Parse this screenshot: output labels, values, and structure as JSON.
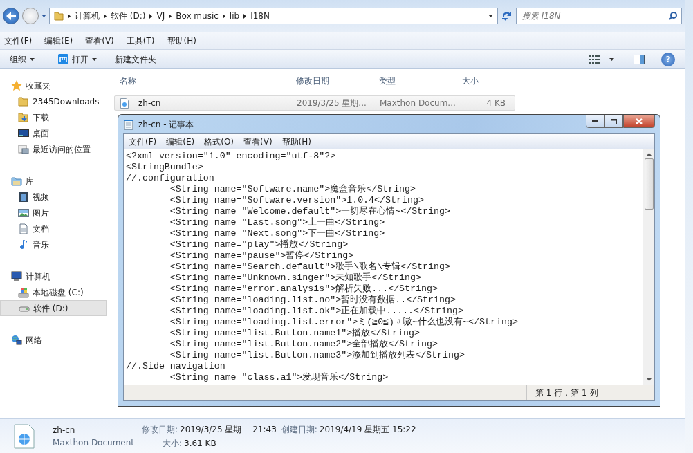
{
  "address_bar": {
    "crumbs": [
      "计算机",
      "软件 (D:)",
      "VJ",
      "Box music",
      "lib",
      "I18N"
    ]
  },
  "search": {
    "placeholder": "搜索 I18N"
  },
  "menu": [
    "文件(F)",
    "编辑(E)",
    "查看(V)",
    "工具(T)",
    "帮助(H)"
  ],
  "toolbar": {
    "organize": "组织",
    "open": "打开",
    "new_folder": "新建文件夹",
    "help": "?"
  },
  "sidebar": {
    "groups": [
      {
        "label": "收藏夹",
        "kind": "favorites",
        "children": [
          {
            "label": "2345Downloads",
            "kind": "folder",
            "selected": false
          },
          {
            "label": "下载",
            "kind": "download",
            "selected": false
          },
          {
            "label": "桌面",
            "kind": "desktop",
            "selected": false
          },
          {
            "label": "最近访问的位置",
            "kind": "recent",
            "selected": false
          }
        ]
      },
      {
        "label": "库",
        "kind": "library",
        "children": [
          {
            "label": "视频",
            "kind": "video",
            "selected": false
          },
          {
            "label": "图片",
            "kind": "image",
            "selected": false
          },
          {
            "label": "文档",
            "kind": "document",
            "selected": false
          },
          {
            "label": "音乐",
            "kind": "music",
            "selected": false
          }
        ]
      },
      {
        "label": "计算机",
        "kind": "computer",
        "children": [
          {
            "label": "本地磁盘 (C:)",
            "kind": "system-drive",
            "selected": false
          },
          {
            "label": "软件 (D:)",
            "kind": "drive",
            "selected": true
          }
        ]
      },
      {
        "label": "网络",
        "kind": "network"
      }
    ]
  },
  "file_list": {
    "columns": [
      "名称",
      "修改日期",
      "类型",
      "大小"
    ],
    "rows": [
      {
        "name": "zh-cn",
        "modified": "2019/3/25 星期...",
        "type": "Maxthon Docum...",
        "size": "4 KB",
        "selected": true
      }
    ]
  },
  "notepad": {
    "title": "zh-cn - 记事本",
    "menu": [
      "文件(F)",
      "编辑(E)",
      "格式(O)",
      "查看(V)",
      "帮助(H)"
    ],
    "lines": [
      "<?xml version=\"1.0\" encoding=\"utf-8\"?>",
      "<StringBundle>",
      "//.configuration",
      "\t<String name=\"Software.name\">魔盒音乐</String>",
      "\t<String name=\"Software.version\">1.0.4</String>",
      "\t<String name=\"Welcome.default\">一切尽在心情~</String>",
      "\t<String name=\"Last.song\">上一曲</String>",
      "\t<String name=\"Next.song\">下一曲</String>",
      "\t<String name=\"play\">播放</String>",
      "\t<String name=\"pause\">暂停</String>",
      "\t<String name=\"Search.default\">歌手\\歌名\\专辑</String>",
      "\t<String name=\"Unknown.singer\">未知歌手</String>",
      "\t<String name=\"error.analysis\">解析失败...</String>",
      "\t<String name=\"loading.list.no\">暂时没有数据..</String>",
      "\t<String name=\"loading.list.ok\">正在加载中.....</String>",
      "\t<String name=\"loading.list.error\">ミ(≧0≦)〃嗷~什么也没有~</String>",
      "\t<String name=\"list.Button.name1\">播放</String>",
      "\t<String name=\"list.Button.name2\">全部播放</String>",
      "\t<String name=\"list.Button.name3\">添加到播放列表</String>",
      "//.Side navigation",
      "\t<String name=\"class.a1\">发现音乐</String>"
    ],
    "status": "第 1 行，第 1 列"
  },
  "details": {
    "name": "zh-cn",
    "type": "Maxthon Document",
    "fields": [
      {
        "label": "修改日期:",
        "value": "2019/3/25 星期一 21:43"
      },
      {
        "label": "创建日期:",
        "value": "2019/4/19 星期五 15:22"
      },
      {
        "label": "大小:",
        "value": "3.61 KB"
      }
    ]
  }
}
